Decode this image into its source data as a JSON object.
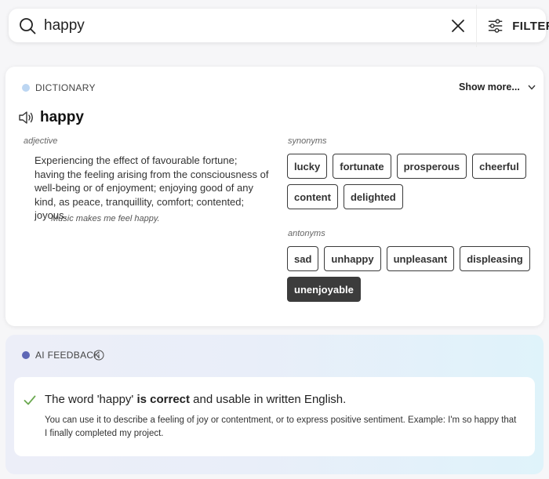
{
  "search": {
    "value": "happy",
    "filter_label": "FILTER"
  },
  "dictionary": {
    "section_label": "DICTIONARY",
    "show_more_label": "Show more...",
    "word": "happy",
    "part_of_speech": "adjective",
    "definition": "Experiencing the effect of favourable fortune; having the feeling arising from the consciousness of well-being or of enjoyment; enjoying good of any kind, as peace, tranquillity, comfort; contented; joyous.",
    "example": "Music makes me feel happy.",
    "synonyms_label": "synonyms",
    "synonyms": [
      "lucky",
      "fortunate",
      "prosperous",
      "cheerful",
      "content",
      "delighted"
    ],
    "antonyms_label": "antonyms",
    "antonyms": [
      "sad",
      "unhappy",
      "unpleasant",
      "displeasing",
      "unenjoyable"
    ]
  },
  "ai_feedback": {
    "section_label": "AI FEEDBACK",
    "verdict_prefix": "The word 'happy' ",
    "verdict_emphasis": "is correct",
    "verdict_suffix": " and usable in written English.",
    "detail": "You can use it to describe a feeling of joy or contentment, or to express positive sentiment. Example: I'm so happy that I finally completed my project."
  },
  "icons": {
    "search": "search-icon",
    "clear": "close-icon",
    "filter": "sliders-icon",
    "show_more": "chevron-down-icon",
    "pronounce": "speaker-icon",
    "info": "info-icon",
    "check": "check-icon"
  },
  "colors": {
    "dictionary_dot": "#bcd6f2",
    "ai_dot": "#5e67b6",
    "check": "#6aa84f",
    "selected_chip": "#3c3c3c"
  }
}
